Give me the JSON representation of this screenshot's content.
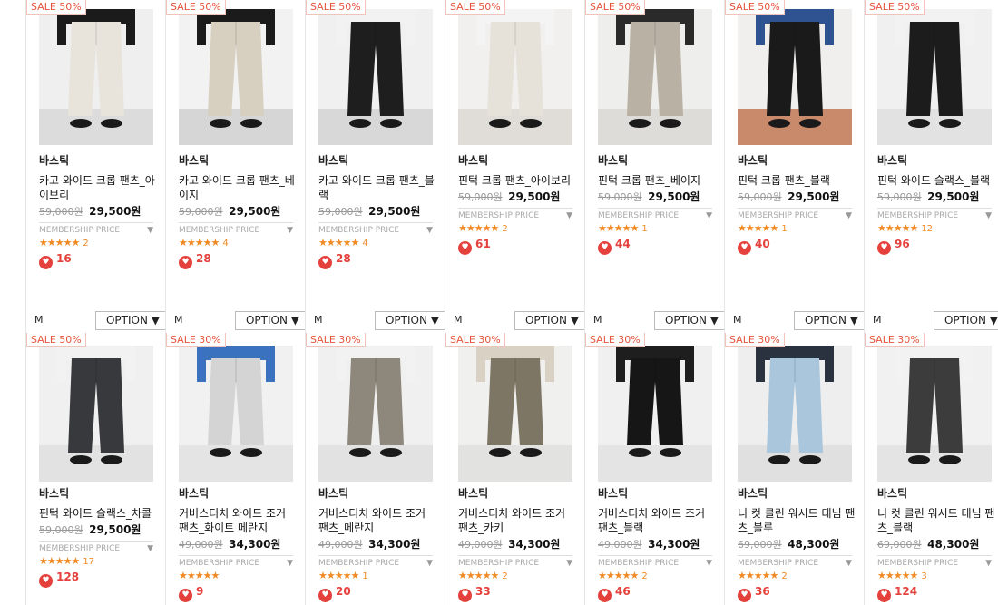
{
  "products": [
    {
      "badge": "SALE 50%",
      "brand": "바스틱",
      "name": "카고 와이드 크롭 팬츠_아이보리",
      "orig": "59,000원",
      "sale": "29,500원",
      "member": "MEMBERSHIP PRICE",
      "stars": "★★★★★",
      "rating_count": "2",
      "likes": "16",
      "pants_color": "#e8e4dc",
      "top_color": "#1b1b1b",
      "bg": "#efefef",
      "floor": "#dcdcdc"
    },
    {
      "badge": "SALE 50%",
      "brand": "바스틱",
      "name": "카고 와이드 크롭 팬츠_베이지",
      "orig": "59,000원",
      "sale": "29,500원",
      "member": "MEMBERSHIP PRICE",
      "stars": "★★★★★",
      "rating_count": "4",
      "likes": "28",
      "pants_color": "#d7cfc0",
      "top_color": "#1b1b1b",
      "bg": "#f2f2f2",
      "floor": "#d6d6d6"
    },
    {
      "badge": "SALE 50%",
      "brand": "바스틱",
      "name": "카고 와이드 크롭 팬츠_블랙",
      "orig": "59,000원",
      "sale": "29,500원",
      "member": "MEMBERSHIP PRICE",
      "stars": "★★★★★",
      "rating_count": "4",
      "likes": "28",
      "pants_color": "#1e1e1e",
      "top_color": "#f2f2f2",
      "bg": "#f0f0f0",
      "floor": "#d8d8d8"
    },
    {
      "badge": "SALE 50%",
      "brand": "바스틱",
      "name": "핀턱 크롭 팬츠_아이보리",
      "orig": "59,000원",
      "sale": "29,500원",
      "member": "MEMBERSHIP PRICE",
      "stars": "★★★★★",
      "rating_count": "2",
      "likes": "61",
      "pants_color": "#e6e2da",
      "top_color": "#f4f4f4",
      "bg": "#f1f0ee",
      "floor": "#e0ddd8"
    },
    {
      "badge": "SALE 50%",
      "brand": "바스틱",
      "name": "핀턱 크롭 팬츠_베이지",
      "orig": "59,000원",
      "sale": "29,500원",
      "member": "MEMBERSHIP PRICE",
      "stars": "★★★★★",
      "rating_count": "1",
      "likes": "44",
      "pants_color": "#b9b1a4",
      "top_color": "#2a2a2a",
      "bg": "#eeeeec",
      "floor": "#dedcd8"
    },
    {
      "badge": "SALE 50%",
      "brand": "바스틱",
      "name": "핀턱 크롭 팬츠_블랙",
      "orig": "59,000원",
      "sale": "29,500원",
      "member": "MEMBERSHIP PRICE",
      "stars": "★★★★★",
      "rating_count": "1",
      "likes": "40",
      "pants_color": "#1a1a1a",
      "top_color": "#2f5290",
      "bg": "#f0efed",
      "floor": "#c98a6c"
    },
    {
      "badge": "SALE 50%",
      "brand": "바스틱",
      "name": "핀턱 와이드 슬랙스_블랙",
      "orig": "59,000원",
      "sale": "29,500원",
      "member": "MEMBERSHIP PRICE",
      "stars": "★★★★★",
      "rating_count": "12",
      "likes": "96",
      "pants_color": "#1c1c1c",
      "top_color": "#f2f2f2",
      "bg": "#f0f0f0",
      "floor": "#e2e2e2"
    },
    {
      "badge": "SALE 50%",
      "brand": "바스틱",
      "name": "핀턱 와이드 슬랙스_차콜",
      "orig": "59,000원",
      "sale": "29,500원",
      "member": "MEMBERSHIP PRICE",
      "stars": "★★★★★",
      "rating_count": "17",
      "likes": "128",
      "pants_color": "#38393c",
      "top_color": "#f2f2f2",
      "bg": "#f0f0f0",
      "floor": "#e2e2e2"
    },
    {
      "badge": "SALE 30%",
      "brand": "바스틱",
      "name": "커버스티치 와이드 조거 팬츠_화이트 메란지",
      "orig": "49,000원",
      "sale": "34,300원",
      "member": "MEMBERSHIP PRICE",
      "stars": "★★★★★",
      "rating_count": "",
      "likes": "9",
      "pants_color": "#d4d4d4",
      "top_color": "#3a72c0",
      "bg": "#f1f1f1",
      "floor": "#e4e4e4"
    },
    {
      "badge": "SALE 30%",
      "brand": "바스틱",
      "name": "커버스티치 와이드 조거 팬츠_메란지",
      "orig": "49,000원",
      "sale": "34,300원",
      "member": "MEMBERSHIP PRICE",
      "stars": "★★★★★",
      "rating_count": "1",
      "likes": "20",
      "pants_color": "#8e877c",
      "top_color": "#f2f2f2",
      "bg": "#f0f0f0",
      "floor": "#e2e2e2"
    },
    {
      "badge": "SALE 30%",
      "brand": "바스틱",
      "name": "커버스티치 와이드 조거 팬츠_카키",
      "orig": "49,000원",
      "sale": "34,300원",
      "member": "MEMBERSHIP PRICE",
      "stars": "★★★★★",
      "rating_count": "2",
      "likes": "33",
      "pants_color": "#7d7664",
      "top_color": "#d9d2c4",
      "bg": "#f0f0ee",
      "floor": "#e2e2e0"
    },
    {
      "badge": "SALE 30%",
      "brand": "바스틱",
      "name": "커버스티치 와이드 조거 팬츠_블랙",
      "orig": "49,000원",
      "sale": "34,300원",
      "member": "MEMBERSHIP PRICE",
      "stars": "★★★★★",
      "rating_count": "2",
      "likes": "46",
      "pants_color": "#161616",
      "top_color": "#1e1e1e",
      "bg": "#f0f0f0",
      "floor": "#e4e4e4"
    },
    {
      "badge": "SALE 30%",
      "brand": "바스틱",
      "name": "니 컷 클린 워시드 데님 팬츠_블루",
      "orig": "69,000원",
      "sale": "48,300원",
      "member": "MEMBERSHIP PRICE",
      "stars": "★★★★★",
      "rating_count": "2",
      "likes": "36",
      "pants_color": "#a9c6dc",
      "top_color": "#2a3240",
      "bg": "#eeeeee",
      "floor": "#e0e0e0"
    },
    {
      "badge": "SALE 30%",
      "brand": "바스틱",
      "name": "니 컷 클린 워시드 데님 팬츠_블랙",
      "orig": "69,000원",
      "sale": "48,300원",
      "member": "MEMBERSHIP PRICE",
      "stars": "★★★★★",
      "rating_count": "3",
      "likes": "124",
      "pants_color": "#3c3c3c",
      "top_color": "#f2f2f2",
      "bg": "#f1f1f1",
      "floor": "#e4e4e4"
    }
  ],
  "bottombar": {
    "m_label": "M",
    "option_label": "OPTION ▼"
  },
  "colors": {
    "accent_red": "#e5413c",
    "star_orange": "#f08a24"
  }
}
